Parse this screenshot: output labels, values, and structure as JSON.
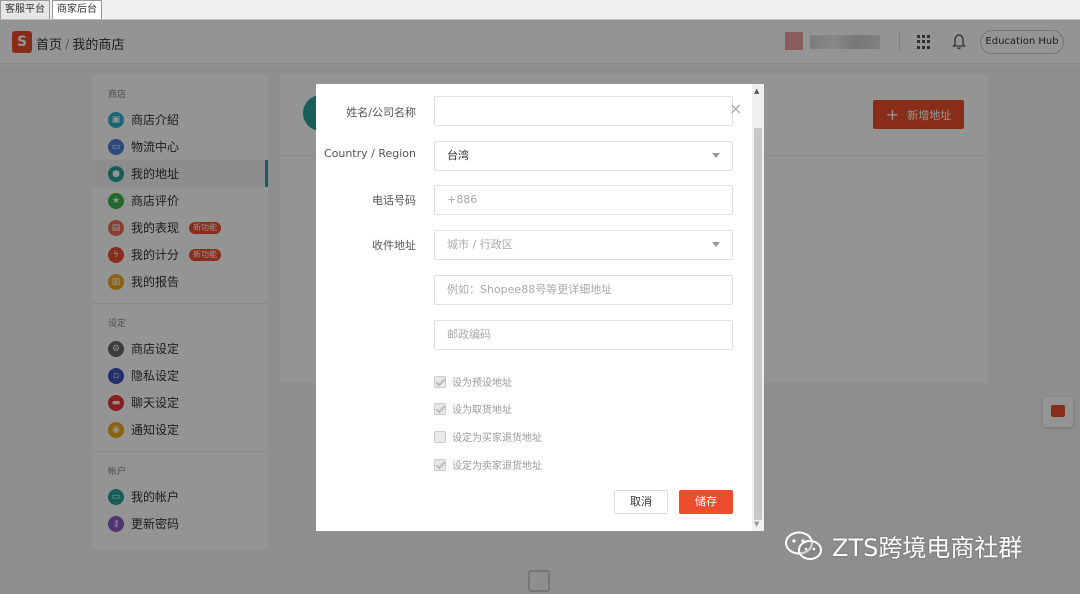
{
  "browser_tabs": [
    {
      "label": "客服平台"
    },
    {
      "label": "商家后台"
    }
  ],
  "header": {
    "logo_letter": "S",
    "breadcrumb_home": "首页",
    "breadcrumb_separator": "/",
    "breadcrumb_current": "我的商店",
    "education_hub": "Education Hub"
  },
  "sidebar": {
    "sections": [
      {
        "heading": "商店",
        "items": [
          {
            "label": "商店介紹",
            "color": "#2ab0c5",
            "icon": "store-icon"
          },
          {
            "label": "物流中心",
            "color": "#4a7fd4",
            "icon": "truck-icon"
          },
          {
            "label": "我的地址",
            "color": "#2aa198",
            "icon": "location-icon",
            "active": true
          },
          {
            "label": "商店评价",
            "color": "#3bb54a",
            "icon": "star-icon"
          },
          {
            "label": "我的表现",
            "color": "#ee6a55",
            "icon": "chart-icon",
            "badge": "新功能"
          },
          {
            "label": "我的计分",
            "color": "#ee4d2d",
            "icon": "bolt-icon",
            "badge": "新功能"
          },
          {
            "label": "我的报告",
            "color": "#f0a81e",
            "icon": "report-icon"
          }
        ]
      },
      {
        "heading": "设定",
        "items": [
          {
            "label": "商店设定",
            "color": "#666666",
            "icon": "gear-icon"
          },
          {
            "label": "隐私设定",
            "color": "#3f51b5",
            "icon": "lock-icon"
          },
          {
            "label": "聊天设定",
            "color": "#e53935",
            "icon": "chat-icon"
          },
          {
            "label": "通知设定",
            "color": "#f0a81e",
            "icon": "bell-icon"
          }
        ]
      },
      {
        "heading": "帐户",
        "items": [
          {
            "label": "我的帐户",
            "color": "#2aa198",
            "icon": "card-icon"
          },
          {
            "label": "更新密码",
            "color": "#8e5cc9",
            "icon": "key-icon"
          }
        ]
      }
    ]
  },
  "main": {
    "add_address_label": "新增地址",
    "add_icon": "+"
  },
  "modal": {
    "close_icon": "×",
    "name_label": "姓名/公司名称",
    "name_value": "",
    "country_label": "Country / Region",
    "country_value": "台湾",
    "phone_label": "电话号码",
    "phone_placeholder": "+886",
    "address_label": "收件地址",
    "city_placeholder": "城市 / 行政区",
    "detail_placeholder": "例如：Shopee88号等更详细地址",
    "zip_placeholder": "邮政编码",
    "checkboxes": [
      {
        "label": "设为预设地址",
        "checked": true
      },
      {
        "label": "设为取货地址",
        "checked": true
      },
      {
        "label": "设定为买家退货地址",
        "checked": false
      },
      {
        "label": "设定为卖家退货地址",
        "checked": true
      }
    ],
    "cancel_label": "取消",
    "save_label": "储存"
  },
  "watermark": {
    "text": "ZTS跨境电商社群"
  },
  "colors": {
    "brand": "#ee4d2d",
    "active_accent": "#2aa198"
  }
}
